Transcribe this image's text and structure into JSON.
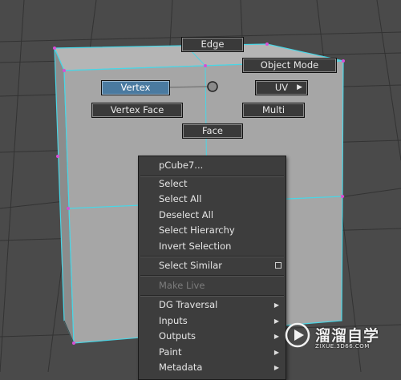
{
  "marking_menu": {
    "north": "Edge",
    "north_east": "Object Mode",
    "west": "Vertex",
    "east": "UV",
    "south_west": "Vertex Face",
    "south_east": "Multi",
    "south": "Face",
    "active_item": "Vertex"
  },
  "context_menu": {
    "object_name": "pCube7...",
    "items": [
      {
        "label": "Select",
        "enabled": true
      },
      {
        "label": "Select All",
        "enabled": true
      },
      {
        "label": "Deselect All",
        "enabled": true
      },
      {
        "label": "Select Hierarchy",
        "enabled": true
      },
      {
        "label": "Invert Selection",
        "enabled": true
      },
      {
        "label": "Select Similar",
        "enabled": true,
        "option_box": true
      },
      {
        "label": "Make Live",
        "enabled": false
      },
      {
        "label": "DG Traversal",
        "enabled": true,
        "submenu": true
      },
      {
        "label": "Inputs",
        "enabled": true,
        "submenu": true
      },
      {
        "label": "Outputs",
        "enabled": true,
        "submenu": true
      },
      {
        "label": "Paint",
        "enabled": true,
        "submenu": true
      },
      {
        "label": "Metadata",
        "enabled": true,
        "submenu": true
      }
    ]
  },
  "icons": {
    "submenu": "arrow-right-icon",
    "option_box": "option-box-icon",
    "marking_center": "marking-menu-center-icon"
  },
  "watermark": {
    "title": "溜溜自学",
    "url": "ZIXUE.3D66.COM"
  },
  "colors": {
    "viewport_bg": "#4a4a4a",
    "cube_face": "#a6a6a6",
    "wireframe_highlight": "#49d6e6",
    "vertex_highlight": "#d64fd6",
    "active_button": "#4a7aa0",
    "menu_bg": "#3d3d3d"
  }
}
